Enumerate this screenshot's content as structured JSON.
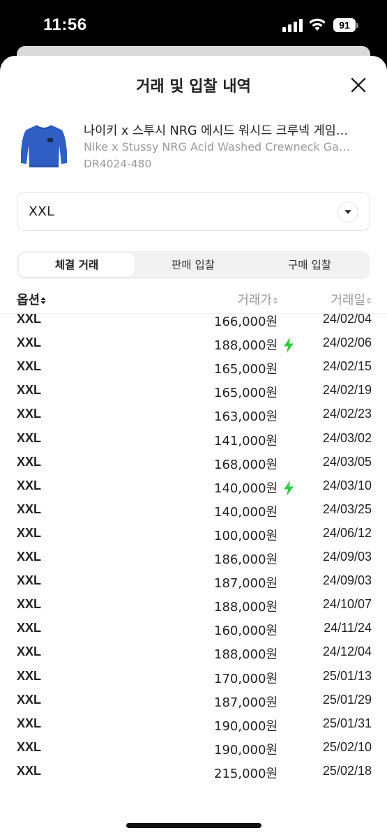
{
  "status_bar": {
    "time": "11:56",
    "battery": "91"
  },
  "sheet": {
    "title": "거래 및 입찰 내역",
    "close_icon": "close-icon"
  },
  "product": {
    "name_ko": "나이키 x 스투시 NRG 에시드 워시드 크루넥 게임…",
    "name_en": "Nike x Stussy NRG Acid Washed Crewneck Ga…",
    "code": "DR4024-480",
    "image_color": "#2f5fc4"
  },
  "size_select": {
    "value": "XXL"
  },
  "tabs": [
    {
      "label": "체결 거래",
      "active": true
    },
    {
      "label": "판매 입찰",
      "active": false
    },
    {
      "label": "구매 입찰",
      "active": false
    }
  ],
  "table": {
    "headers": {
      "option": "옵션",
      "price": "거래가",
      "date": "거래일"
    },
    "rows": [
      {
        "option": "XXL",
        "price": "166,000원",
        "date": "24/02/04",
        "quick": false
      },
      {
        "option": "XXL",
        "price": "188,000원",
        "date": "24/02/06",
        "quick": true
      },
      {
        "option": "XXL",
        "price": "165,000원",
        "date": "24/02/15",
        "quick": false
      },
      {
        "option": "XXL",
        "price": "165,000원",
        "date": "24/02/19",
        "quick": false
      },
      {
        "option": "XXL",
        "price": "163,000원",
        "date": "24/02/23",
        "quick": false
      },
      {
        "option": "XXL",
        "price": "141,000원",
        "date": "24/03/02",
        "quick": false
      },
      {
        "option": "XXL",
        "price": "168,000원",
        "date": "24/03/05",
        "quick": false
      },
      {
        "option": "XXL",
        "price": "140,000원",
        "date": "24/03/10",
        "quick": true
      },
      {
        "option": "XXL",
        "price": "140,000원",
        "date": "24/03/25",
        "quick": false
      },
      {
        "option": "XXL",
        "price": "100,000원",
        "date": "24/06/12",
        "quick": false
      },
      {
        "option": "XXL",
        "price": "186,000원",
        "date": "24/09/03",
        "quick": false
      },
      {
        "option": "XXL",
        "price": "187,000원",
        "date": "24/09/03",
        "quick": false
      },
      {
        "option": "XXL",
        "price": "188,000원",
        "date": "24/10/07",
        "quick": false
      },
      {
        "option": "XXL",
        "price": "160,000원",
        "date": "24/11/24",
        "quick": false
      },
      {
        "option": "XXL",
        "price": "188,000원",
        "date": "24/12/04",
        "quick": false
      },
      {
        "option": "XXL",
        "price": "170,000원",
        "date": "25/01/13",
        "quick": false
      },
      {
        "option": "XXL",
        "price": "187,000원",
        "date": "25/01/29",
        "quick": false
      },
      {
        "option": "XXL",
        "price": "190,000원",
        "date": "25/01/31",
        "quick": false
      },
      {
        "option": "XXL",
        "price": "190,000원",
        "date": "25/02/10",
        "quick": false
      },
      {
        "option": "XXL",
        "price": "215,000원",
        "date": "25/02/18",
        "quick": false
      }
    ]
  },
  "colors": {
    "lightning": "#2ecc40",
    "text": "#222222",
    "muted": "#9a9a9a"
  }
}
